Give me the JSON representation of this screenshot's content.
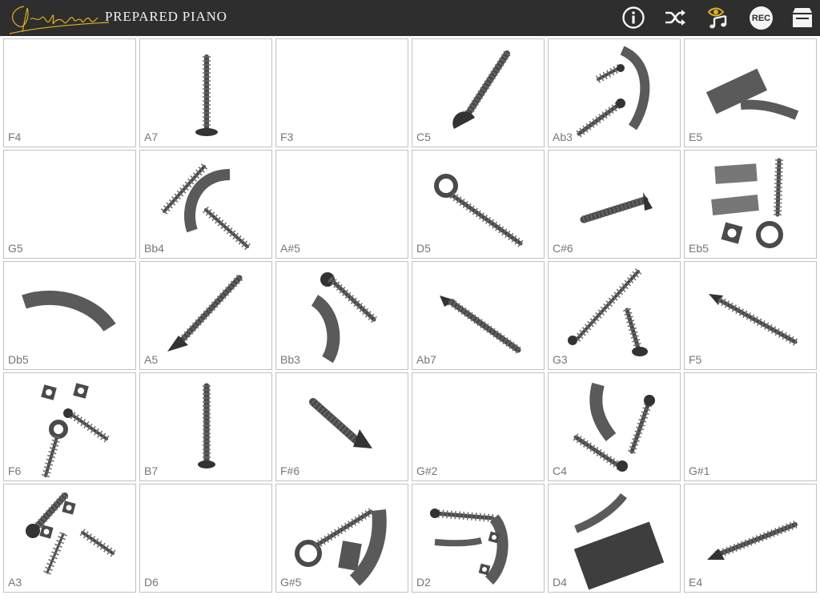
{
  "app": {
    "title": "PREPARED PIANO",
    "logo_signature": "John Cage"
  },
  "toolbar": {
    "icons": [
      "info-icon",
      "shuffle-icon",
      "music-note-eye-icon",
      "rec-icon",
      "archive-box-icon"
    ],
    "rec_label": "REC"
  },
  "colors": {
    "topbar": "#2e2e2e",
    "signature": "#e0b020",
    "cell_border": "#c2c2c2",
    "label": "#777777",
    "hardware": "#4a4a4a"
  },
  "cells": [
    {
      "note": "F4",
      "objects": []
    },
    {
      "note": "A7",
      "objects": [
        "vertical-screw"
      ]
    },
    {
      "note": "F3",
      "objects": []
    },
    {
      "note": "C5",
      "objects": [
        "carriage-bolt"
      ]
    },
    {
      "note": "Ab3",
      "objects": [
        "bolt",
        "bolt",
        "rubber-arc"
      ]
    },
    {
      "note": "E5",
      "objects": [
        "felt-strip",
        "rubber-arc"
      ]
    },
    {
      "note": "G5",
      "objects": []
    },
    {
      "note": "Bb4",
      "objects": [
        "screw",
        "rubber-arc",
        "screw"
      ]
    },
    {
      "note": "A#5",
      "objects": []
    },
    {
      "note": "D5",
      "objects": [
        "eye-bolt"
      ]
    },
    {
      "note": "C#6",
      "objects": [
        "wood-screw"
      ]
    },
    {
      "note": "Eb5",
      "objects": [
        "rubber-piece",
        "rubber-piece",
        "nut",
        "eye-bolt"
      ]
    },
    {
      "note": "Db5",
      "objects": [
        "rubber-arc"
      ]
    },
    {
      "note": "A5",
      "objects": [
        "wood-screw"
      ]
    },
    {
      "note": "Bb3",
      "objects": [
        "bolt",
        "rubber-arc"
      ]
    },
    {
      "note": "Ab7",
      "objects": [
        "wood-screw"
      ]
    },
    {
      "note": "G3",
      "objects": [
        "long-bolt",
        "bolt"
      ]
    },
    {
      "note": "F5",
      "objects": [
        "wood-screw"
      ]
    },
    {
      "note": "F6",
      "objects": [
        "nut",
        "nut",
        "screw",
        "eye-bolt"
      ]
    },
    {
      "note": "B7",
      "objects": [
        "vertical-screw"
      ]
    },
    {
      "note": "F#6",
      "objects": [
        "wood-screw"
      ]
    },
    {
      "note": "G#2",
      "objects": []
    },
    {
      "note": "C4",
      "objects": [
        "rubber-arc",
        "bolt",
        "bolt"
      ]
    },
    {
      "note": "G#1",
      "objects": []
    },
    {
      "note": "A3",
      "objects": [
        "bolt",
        "nut",
        "nut",
        "screw",
        "screw"
      ]
    },
    {
      "note": "D6",
      "objects": []
    },
    {
      "note": "G#5",
      "objects": [
        "eye-bolt",
        "rubber-piece",
        "rubber-arc"
      ]
    },
    {
      "note": "D2",
      "objects": [
        "screw",
        "rubber-arc",
        "rubber-piece",
        "nut"
      ]
    },
    {
      "note": "D4",
      "objects": [
        "rubber-arc",
        "felt-block"
      ]
    },
    {
      "note": "E4",
      "objects": [
        "wood-screw"
      ]
    }
  ]
}
